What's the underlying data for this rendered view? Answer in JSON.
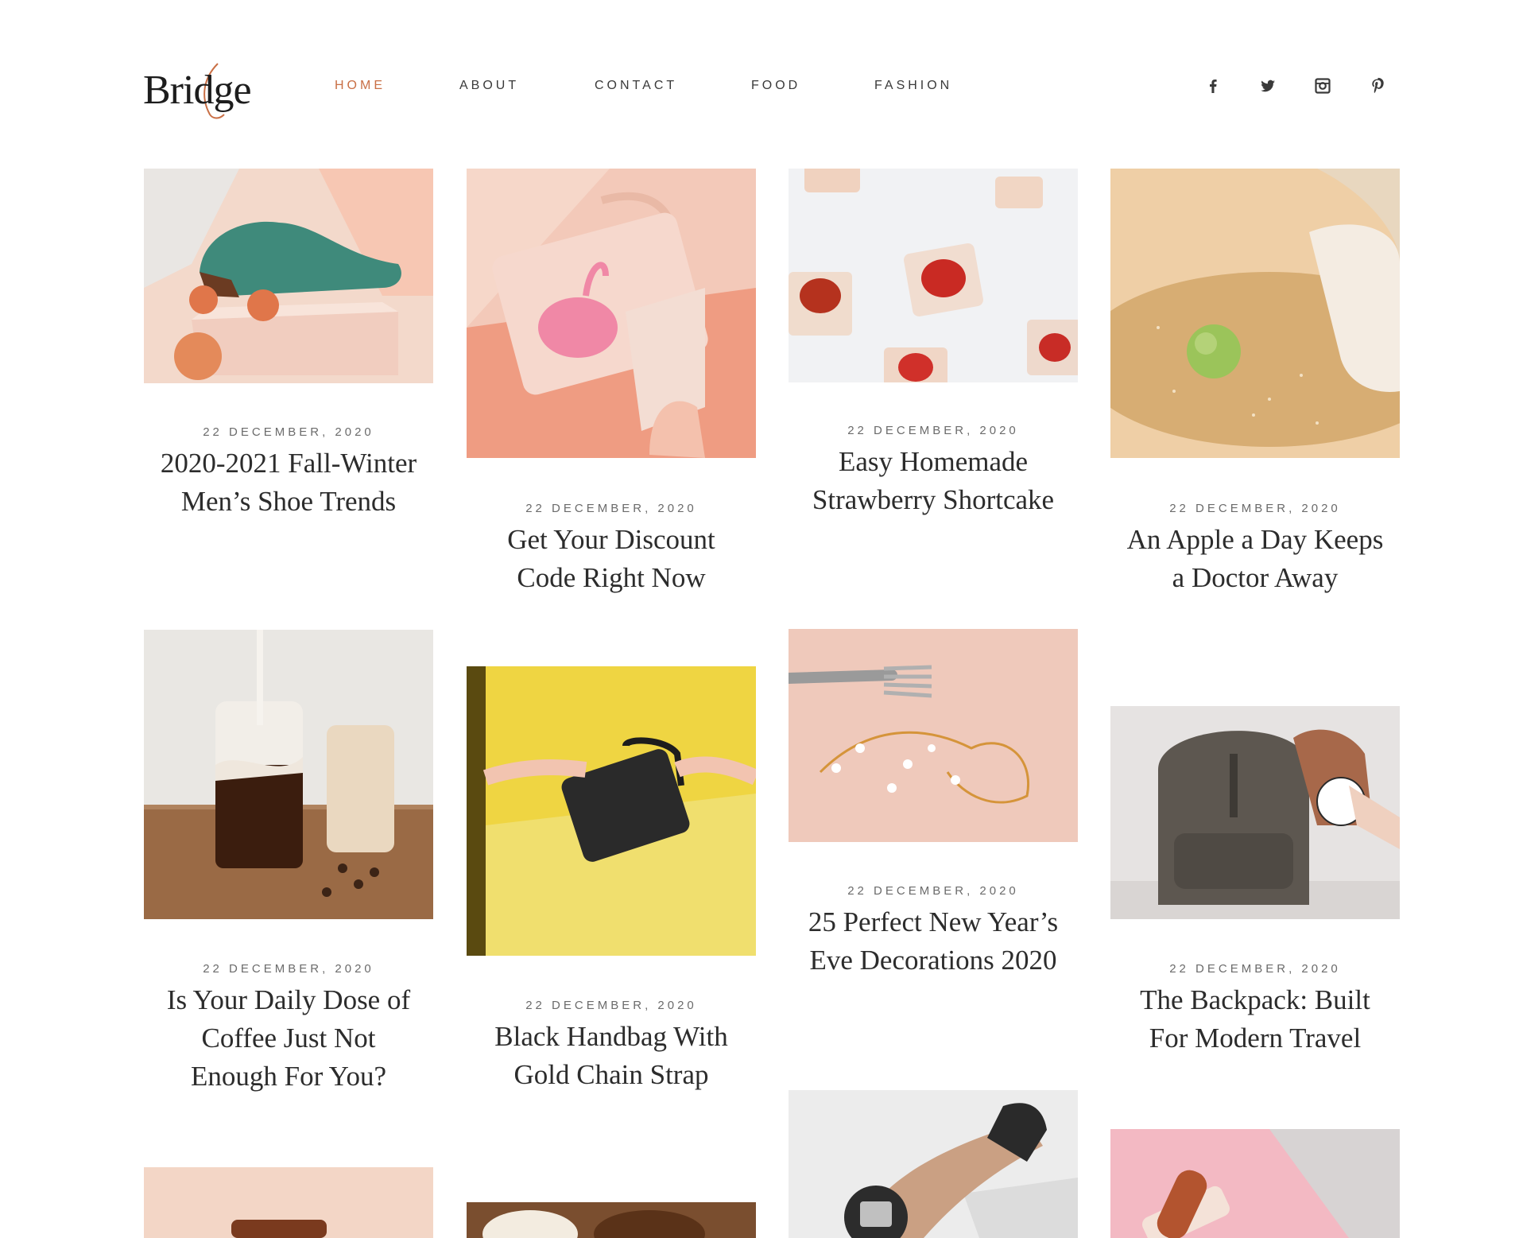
{
  "header": {
    "logo_text": "Bridge",
    "nav": [
      {
        "label": "HOME",
        "active": true
      },
      {
        "label": "ABOUT",
        "active": false
      },
      {
        "label": "CONTACT",
        "active": false
      },
      {
        "label": "FOOD",
        "active": false
      },
      {
        "label": "FASHION",
        "active": false
      }
    ],
    "social": [
      "facebook-icon",
      "twitter-icon",
      "instagram-icon",
      "pinterest-icon"
    ]
  },
  "colors": {
    "accent": "#c96f45",
    "text": "#2c2c2c",
    "date": "#6b6b6b"
  },
  "posts": [
    {
      "date": "22 DECEMBER, 2020",
      "title": "2020-2021 Fall-Winter Men’s Shoe Trends",
      "image": "green-shoe-photo"
    },
    {
      "date": "22 DECEMBER, 2020",
      "title": "Get Your Discount Code Right Now",
      "image": "flamingo-bag-photo"
    },
    {
      "date": "22 DECEMBER, 2020",
      "title": "Easy Homemade Strawberry Shortcake",
      "image": "strawberry-dessert-photo"
    },
    {
      "date": "22 DECEMBER, 2020",
      "title": "An Apple a Day Keeps a Doctor Away",
      "image": "green-apple-photo"
    },
    {
      "date": "22 DECEMBER, 2020",
      "title": "Is Your Daily Dose of Coffee Just Not Enough For You?",
      "image": "iced-coffee-photo"
    },
    {
      "date": "22 DECEMBER, 2020",
      "title": "Black Handbag With Gold Chain Strap",
      "image": "black-handbag-photo"
    },
    {
      "date": "22 DECEMBER, 2020",
      "title": "25 Perfect New Year’s Eve Decorations 2020",
      "image": "gold-hairpiece-photo"
    },
    {
      "date": "22 DECEMBER, 2020",
      "title": "The Backpack: Built For Modern Travel",
      "image": "grey-backpack-photo"
    },
    {
      "image": "sandal-photo"
    },
    {
      "image": "coconut-photo"
    },
    {
      "image": "heeled-mule-photo"
    },
    {
      "image": "pink-shoe-photo"
    }
  ]
}
